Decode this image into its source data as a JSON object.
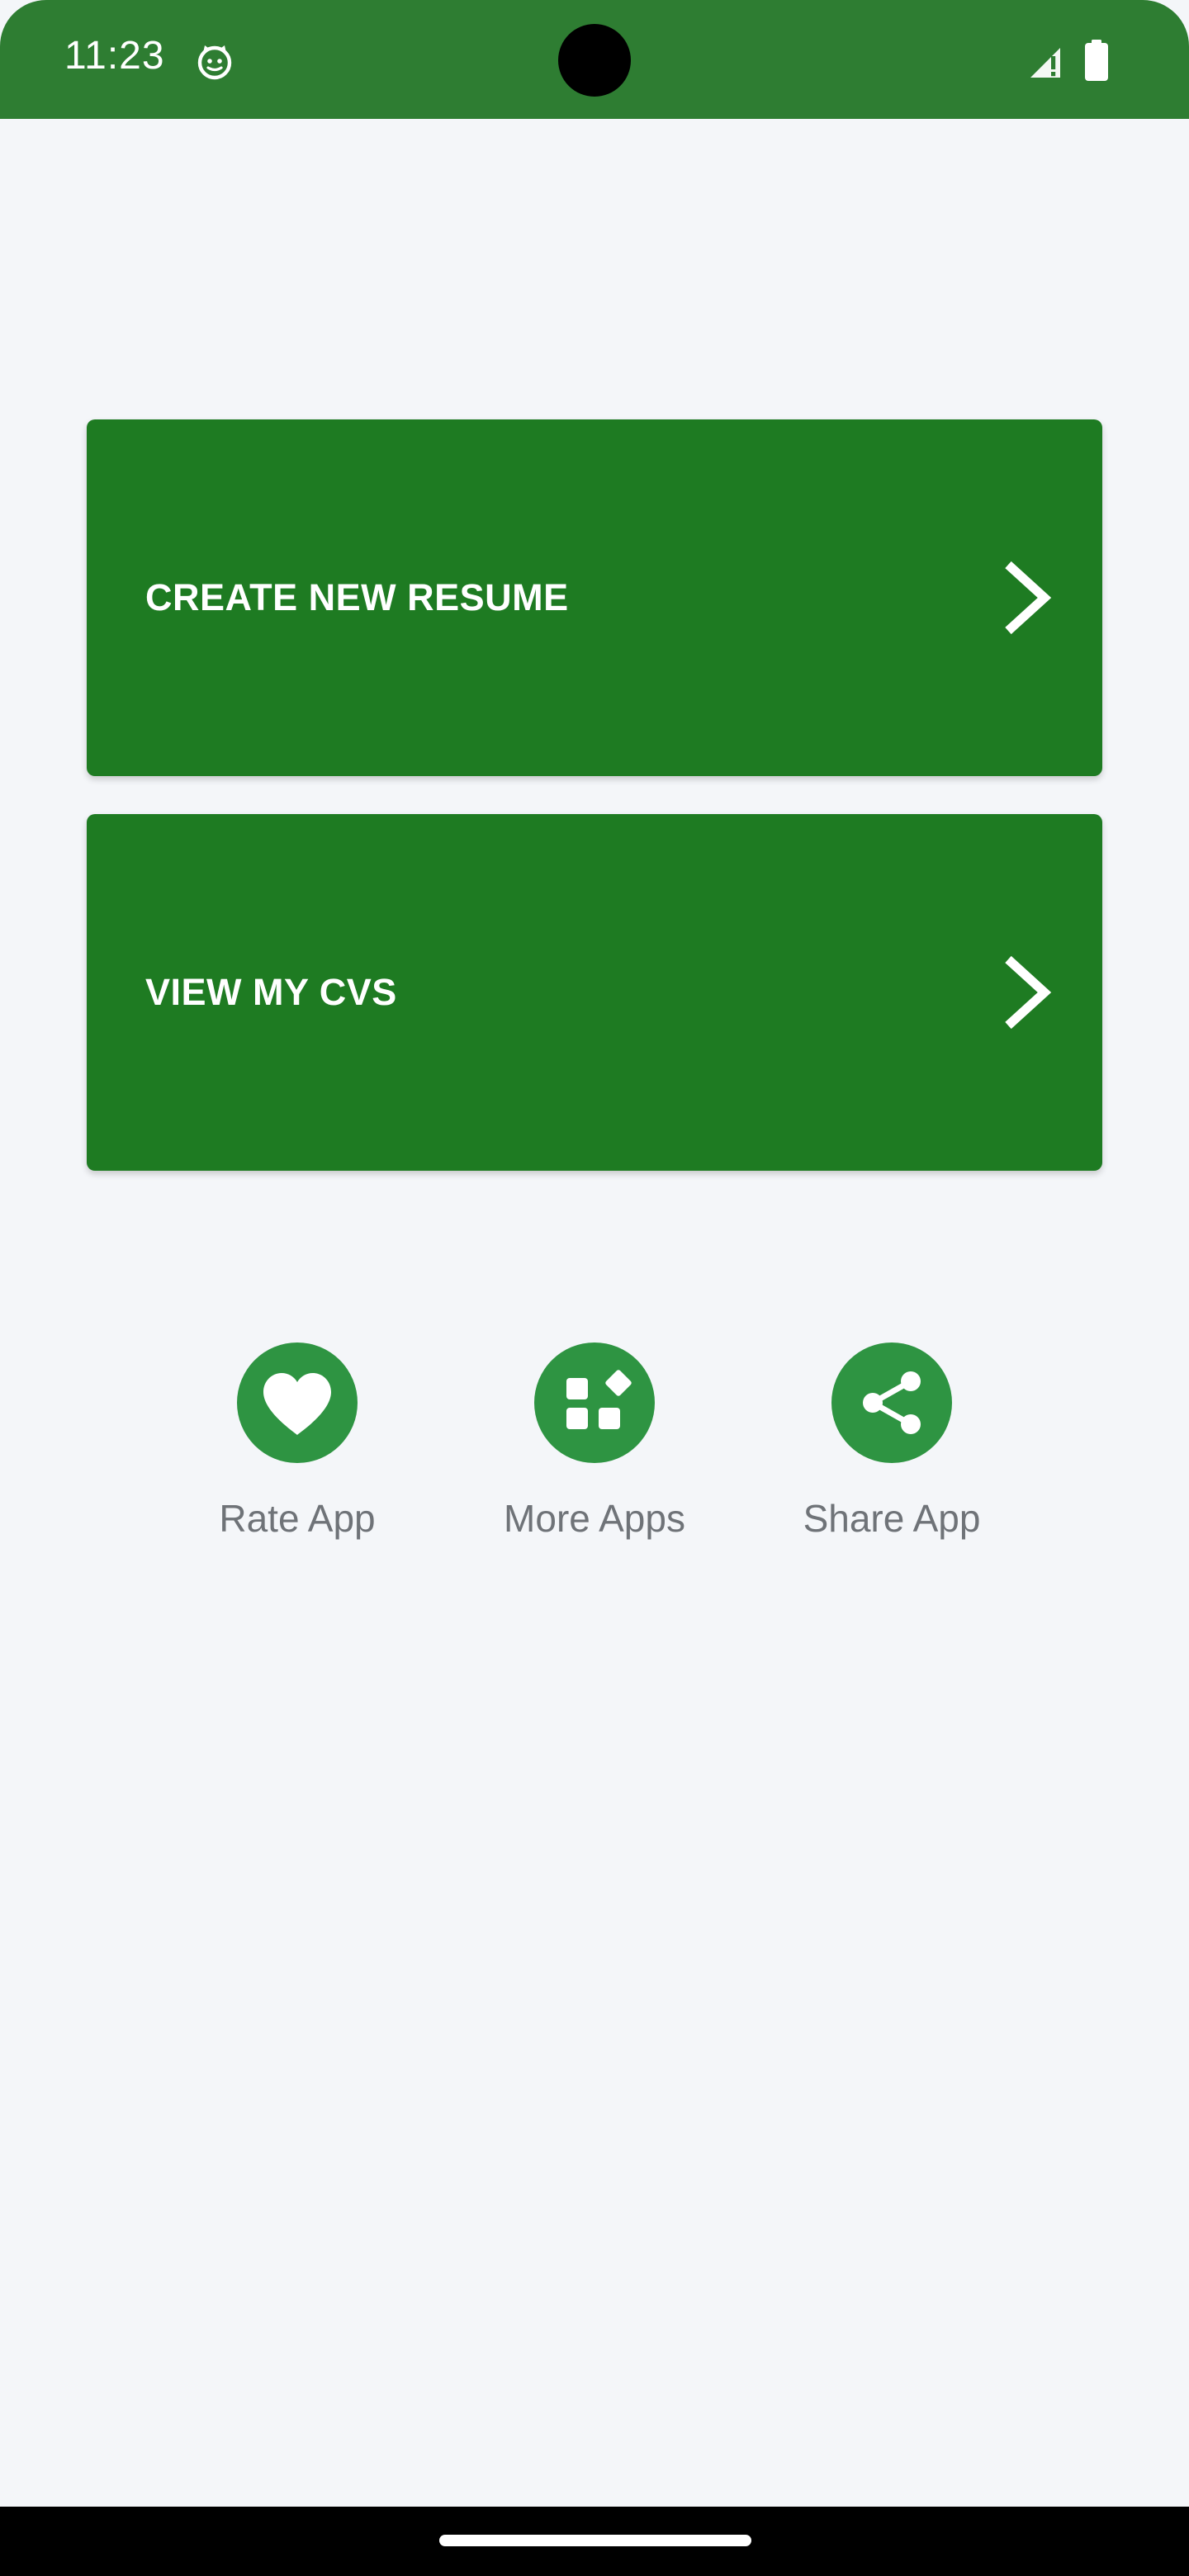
{
  "status_bar": {
    "time": "11:23",
    "app_icon": "cat-face-icon",
    "signal_icon": "signal-alert-icon",
    "battery_icon": "battery-full-icon",
    "background_color": "#2e7d32"
  },
  "main": {
    "cards": [
      {
        "label": "CREATE NEW RESUME",
        "icon": "chevron-right-icon"
      },
      {
        "label": "VIEW MY CVS",
        "icon": "chevron-right-icon"
      }
    ],
    "card_color": "#1e7b22",
    "actions": [
      {
        "label": "Rate App",
        "icon": "heart-icon"
      },
      {
        "label": "More Apps",
        "icon": "apps-grid-icon"
      },
      {
        "label": "Share App",
        "icon": "share-icon"
      }
    ],
    "action_color": "#2e9442"
  },
  "nav_bar": {
    "handle": "home-handle"
  }
}
